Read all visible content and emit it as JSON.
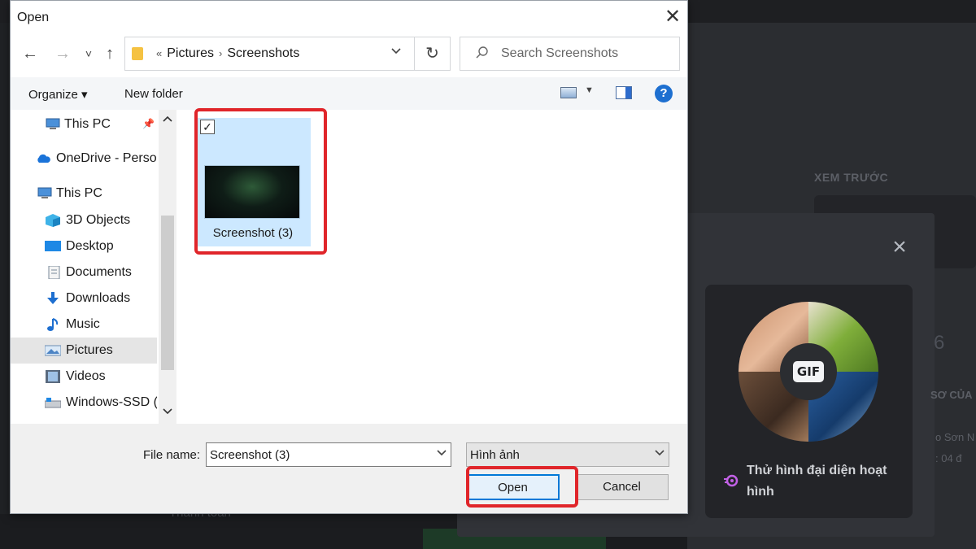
{
  "background_app": {
    "preview_label": "XEM TRƯỚC",
    "bottom_text": "Thanh toán",
    "right_partial_number": "6",
    "right_partial_line1": "SƠ CỦA",
    "right_partial_line2": "o Sơn N",
    "right_partial_line3": ": 04 đ",
    "modal": {
      "close_icon": "×",
      "gif_badge": "GIF",
      "caption": "Thử hình đại diện hoạt hình"
    }
  },
  "dialog": {
    "title": "Open",
    "close_icon": "✕",
    "nav": {
      "back": "←",
      "forward": "→",
      "recent": "˅",
      "up": "↑"
    },
    "address": {
      "crumbs": [
        "Pictures",
        "Screenshots"
      ],
      "prefix": "«",
      "separator": "›"
    },
    "refresh_icon": "↻",
    "search": {
      "placeholder": "Search Screenshots"
    },
    "toolbar": {
      "organize": "Organize ▾",
      "new_folder": "New folder",
      "help": "?"
    },
    "nav_pane": [
      {
        "label": "This PC",
        "icon": "monitor-icon"
      },
      {
        "label": "OneDrive - Person",
        "icon": "cloud-icon"
      },
      {
        "label": "This PC",
        "icon": "monitor-icon"
      },
      {
        "label": "3D Objects",
        "icon": "cube-icon"
      },
      {
        "label": "Desktop",
        "icon": "desktop-icon"
      },
      {
        "label": "Documents",
        "icon": "document-icon"
      },
      {
        "label": "Downloads",
        "icon": "download-icon"
      },
      {
        "label": "Music",
        "icon": "music-icon"
      },
      {
        "label": "Pictures",
        "icon": "pictures-icon",
        "selected": true
      },
      {
        "label": "Videos",
        "icon": "video-icon"
      },
      {
        "label": "Windows-SSD (C",
        "icon": "drive-icon"
      }
    ],
    "files": [
      {
        "name": "Screenshot (3)",
        "selected": true
      }
    ],
    "file_name_label": "File name:",
    "file_name_value": "Screenshot (3)",
    "file_type_value": "Hình ảnh",
    "open_button": "Open",
    "cancel_button": "Cancel"
  },
  "colors": {
    "highlight": "#e0252a",
    "selection": "#cce8ff",
    "accent": "#0078d7"
  }
}
